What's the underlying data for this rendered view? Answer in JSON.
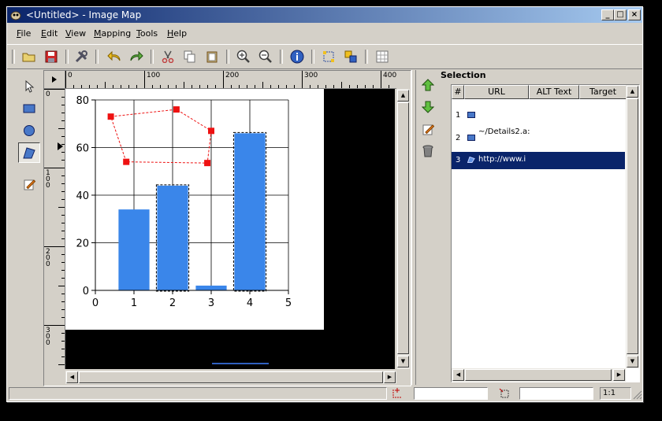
{
  "window": {
    "title": "<Untitled> - Image Map"
  },
  "titlebar_buttons": {
    "min": "_",
    "max": "□",
    "close": "×"
  },
  "menu": [
    {
      "label": "File",
      "key": "F",
      "rest": "ile"
    },
    {
      "label": "Edit",
      "key": "E",
      "rest": "dit"
    },
    {
      "label": "View",
      "key": "V",
      "rest": "iew"
    },
    {
      "label": "Mapping",
      "key": "M",
      "rest": "apping"
    },
    {
      "label": "Tools",
      "key": "T",
      "rest": "ools"
    },
    {
      "label": "Help",
      "key": "H",
      "rest": "elp"
    }
  ],
  "toolbar": [
    "open-icon",
    "save-icon",
    "preferences-icon",
    "undo-icon",
    "redo-icon",
    "cut-icon",
    "copy-icon",
    "paste-icon",
    "zoom-in-icon",
    "zoom-out-icon",
    "info-icon",
    "edit-map-icon",
    "arrange-icon",
    "grid-icon"
  ],
  "tools": [
    "arrow-icon",
    "rectangle-icon",
    "circle-icon",
    "polygon-icon",
    "edit-area-icon"
  ],
  "ruler": {
    "h": [
      "0",
      "100",
      "200",
      "300",
      "400"
    ],
    "v": [
      "0",
      "1\n0\n0",
      "2\n0\n0",
      "3\n0\n0"
    ]
  },
  "chart_data": {
    "type": "bar",
    "categories": [
      1,
      2,
      3,
      4
    ],
    "values": [
      34,
      44,
      2,
      66
    ],
    "xlim": [
      0,
      5
    ],
    "ylim": [
      0,
      80
    ],
    "xticks": [
      "0",
      "1",
      "2",
      "3",
      "4",
      "5"
    ],
    "yticks": [
      "0",
      "20",
      "40",
      "60",
      "80"
    ],
    "grid": true,
    "bar_color": "#3a86ea",
    "selected_bars": [
      2,
      4
    ],
    "polygon_area": {
      "color": "#ee1111",
      "vertices": [
        [
          0.4,
          73
        ],
        [
          2.1,
          76
        ],
        [
          3.0,
          67
        ],
        [
          2.9,
          53.5
        ],
        [
          0.8,
          54
        ]
      ]
    }
  },
  "selection": {
    "title": "Selection",
    "columns": [
      "#",
      "URL",
      "ALT Text",
      "Target"
    ],
    "rows": [
      {
        "num": "1",
        "icon": "rectangle-icon",
        "url": ""
      },
      {
        "num": "2",
        "icon": "rectangle-icon",
        "url": "~/Details2.a:"
      },
      {
        "num": "3",
        "icon": "polygon-icon",
        "url": "http://www.i"
      }
    ],
    "selected_row": 3
  },
  "actions": [
    "move-up-icon",
    "move-down-icon",
    "edit-icon",
    "delete-icon"
  ],
  "status": {
    "zoom": "1:1"
  },
  "colors": {
    "titlebar_start": "#0a246a",
    "titlebar_end": "#a6caf0",
    "selection_bg": "#0a246a",
    "face": "#d4d0c8"
  }
}
